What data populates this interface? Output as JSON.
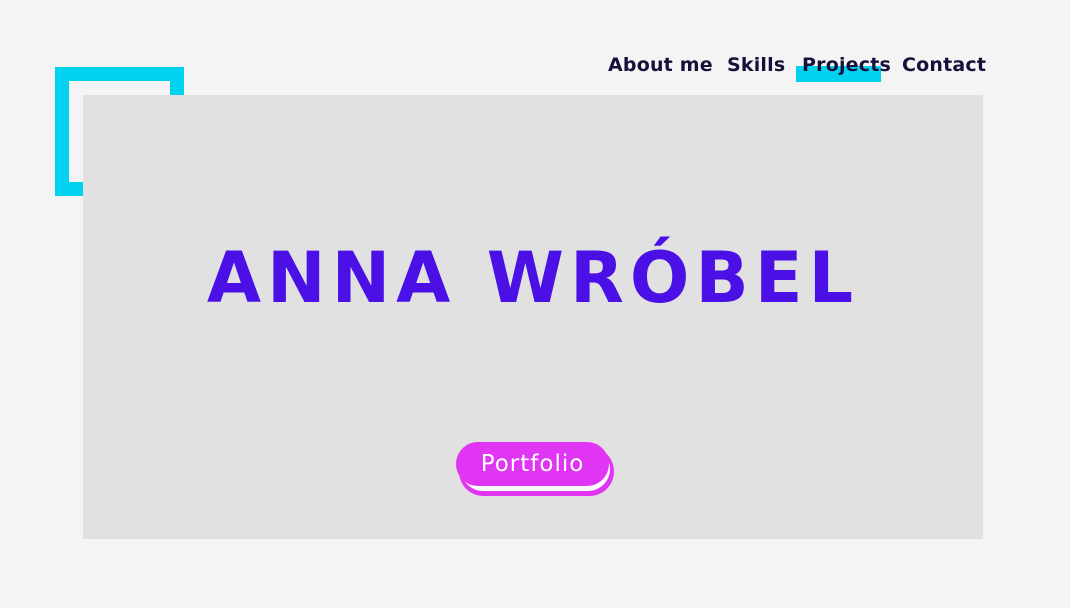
{
  "nav": {
    "items": [
      {
        "label": "About me"
      },
      {
        "label": "Skills"
      },
      {
        "label": "Projects",
        "active": true
      },
      {
        "label": "Contact"
      }
    ]
  },
  "hero": {
    "title": "ANNA WRÓBEL",
    "button_label": "Portfolio"
  },
  "colors": {
    "background": "#f4f4f4",
    "hero_background": "#e1e1e1",
    "accent_cyan": "#00d2f0",
    "title_purple": "#4a10e6",
    "button_magenta": "#e035f3",
    "nav_text": "#14123a"
  }
}
